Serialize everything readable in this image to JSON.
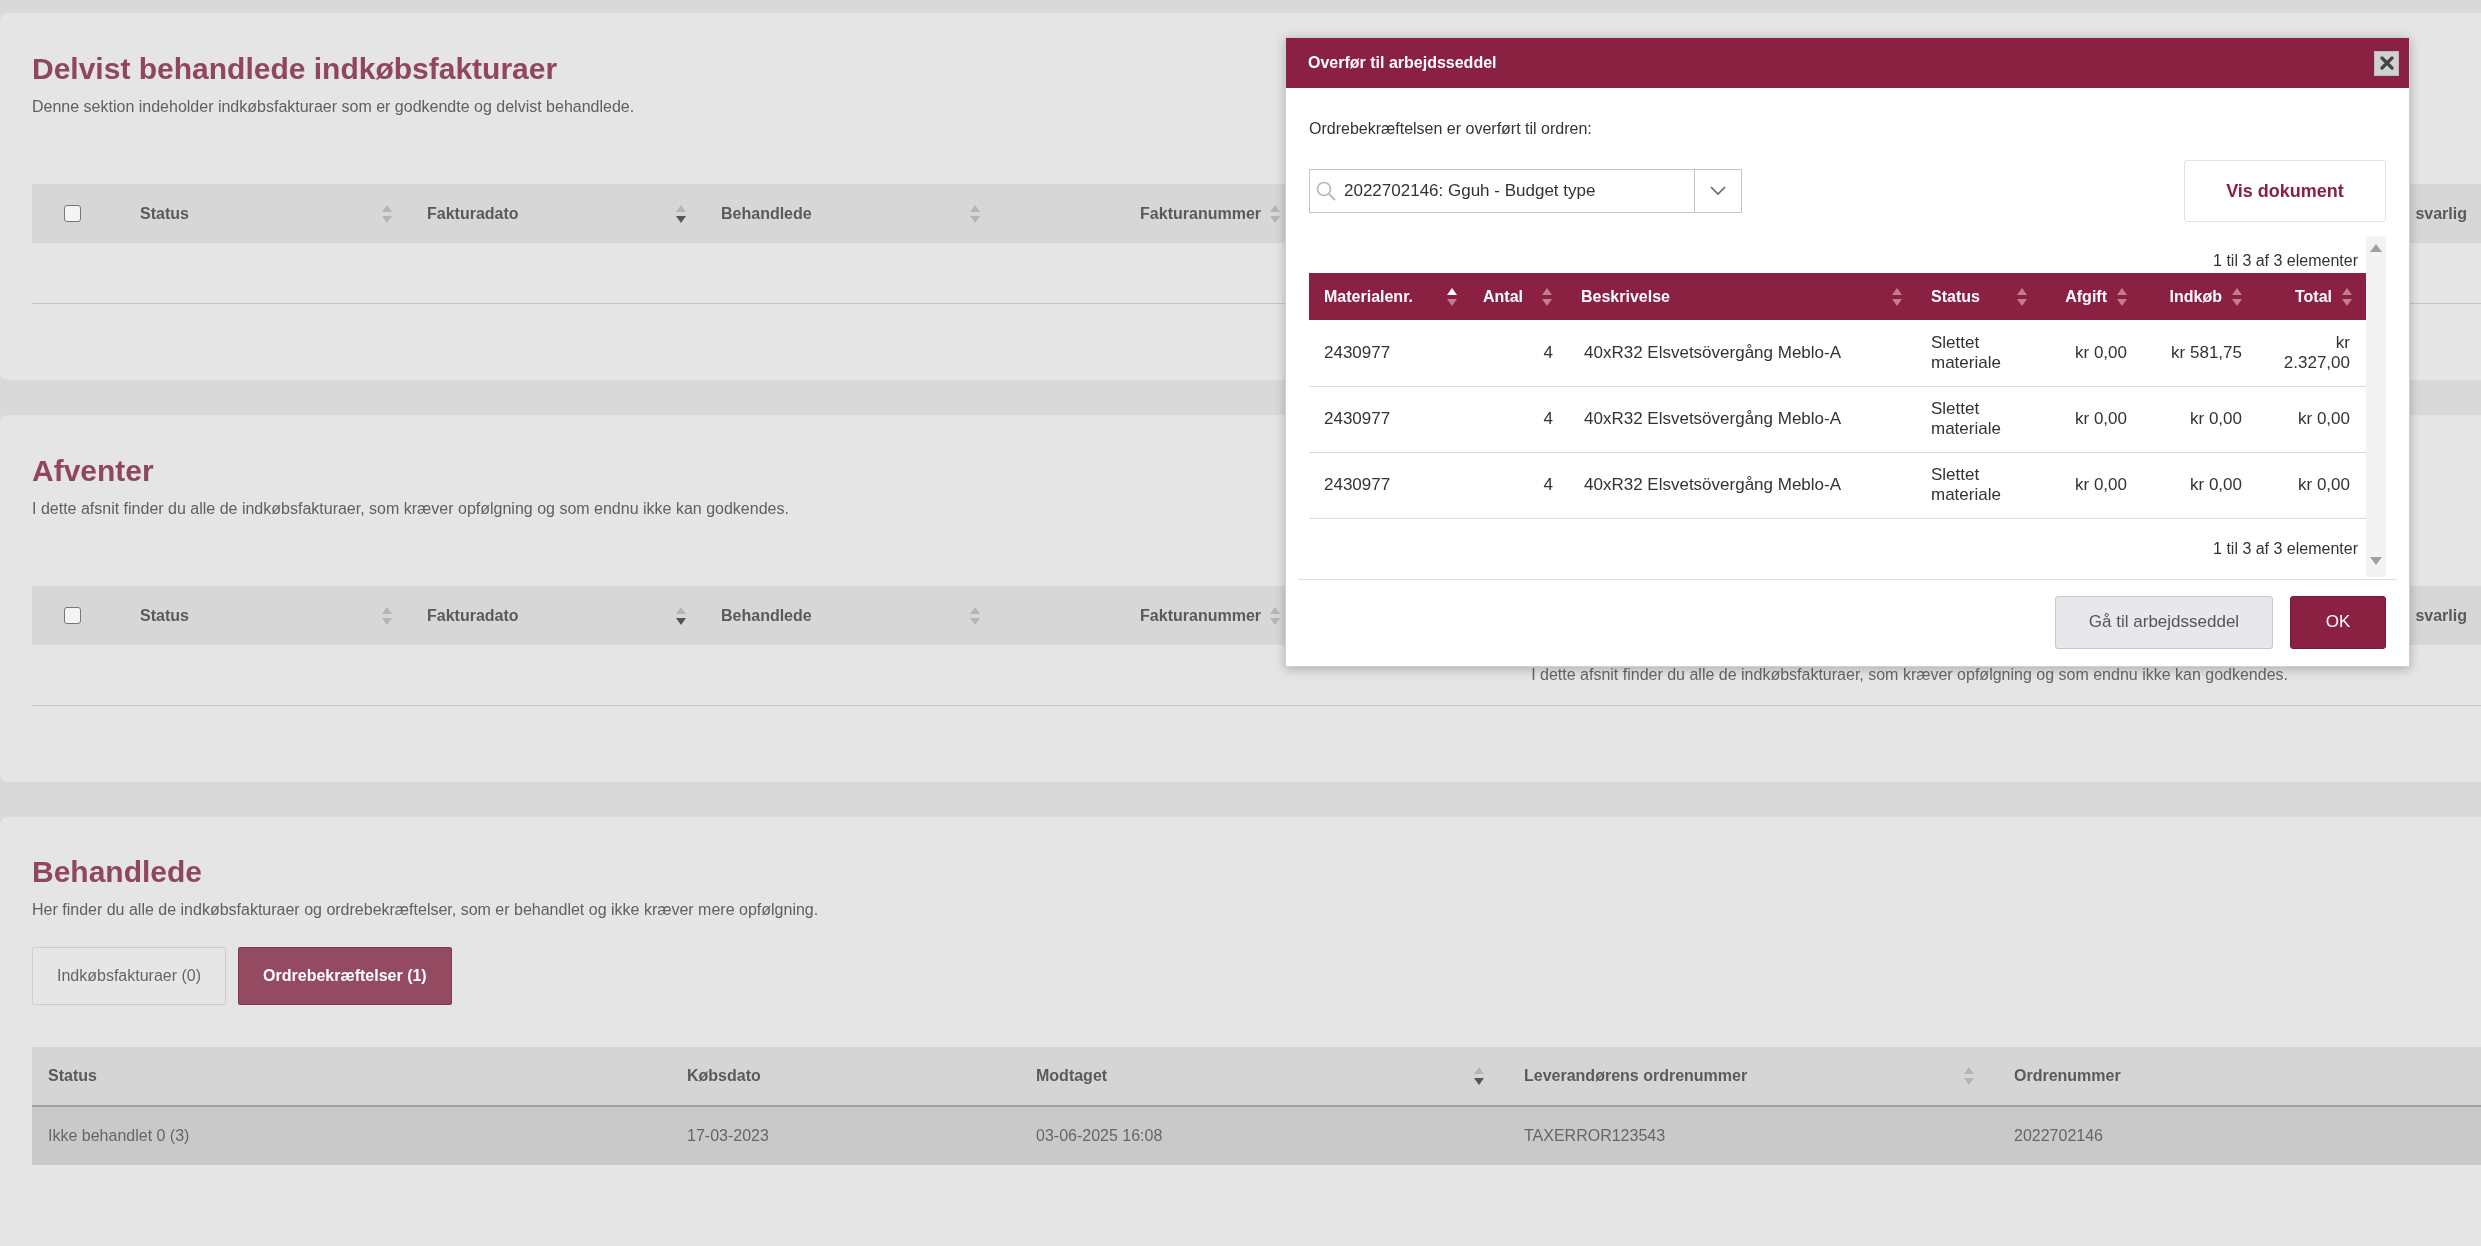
{
  "sections": [
    {
      "title": "Delvist behandlede indkøbsfakturaer",
      "description": "Denne sektion indeholder indkøbsfakturaer som er godkendte og delvist behandlede.",
      "table": {
        "select_all": {
          "checked": false
        },
        "columns": [
          {
            "label": "Status",
            "sorted_up": false,
            "sorted_down": false
          },
          {
            "label": "Fakturadato",
            "sorted_up": false,
            "sorted_down": true
          },
          {
            "label": "Behandlede",
            "sorted_up": false,
            "sorted_down": false
          },
          {
            "label": "Fakturanummer",
            "sorted_up": false,
            "sorted_down": false
          },
          {
            "label": "svarlig"
          }
        ]
      }
    },
    {
      "title": "Afventer",
      "description": "I dette afsnit finder du alle de indkøbsfakturaer, som kræver opfølgning og som endnu ikke kan godkendes.",
      "table": {
        "select_all": {
          "checked": false
        },
        "columns": [
          {
            "label": "Status",
            "sorted_up": false,
            "sorted_down": false
          },
          {
            "label": "Fakturadato",
            "sorted_up": false,
            "sorted_down": true
          },
          {
            "label": "Behandlede",
            "sorted_up": false,
            "sorted_down": false
          },
          {
            "label": "Fakturanummer",
            "sorted_up": false,
            "sorted_down": false
          },
          {
            "label": "svarlig"
          }
        ],
        "empty_message": "I dette afsnit finder du alle de indkøbsfakturaer, som kræver opfølgning og som endnu ikke kan godkendes."
      }
    }
  ],
  "processed": {
    "title": "Behandlede",
    "description": "Her finder du alle de indkøbsfakturaer og ordrebekræftelser, som er behandlet og ikke kræver mere opfølgning.",
    "tabs": [
      {
        "label": "Indkøbsfakturaer (0)",
        "selected": false
      },
      {
        "label": "Ordrebekræftelser (1)",
        "selected": true
      }
    ],
    "table": {
      "columns": [
        {
          "label": "Status"
        },
        {
          "label": "Købsdato"
        },
        {
          "label": "Modtaget",
          "sorted_up": false,
          "sorted_down": true
        },
        {
          "label": "Leverandørens ordrenummer",
          "sorted_up": false,
          "sorted_down": false
        },
        {
          "label": "Ordrenummer"
        }
      ],
      "rows": [
        {
          "selected": true,
          "cells": [
            "Ikke behandlet 0 (3)",
            "17-03-2023",
            "03-06-2025 16:08",
            "TAXERROR123543",
            "2022702146"
          ]
        }
      ]
    }
  },
  "dialog": {
    "title": "Overfør til arbejdsseddel",
    "message": "Ordrebekræftelsen er overført til ordren:",
    "order_field": {
      "value": "2022702146: Gguh - Budget type"
    },
    "view_button": "Vis dokument",
    "count_top": "1 til 3 af 3 elementer",
    "columns": [
      {
        "label": "Materialenr.",
        "sorted_up": true,
        "sorted_down": false
      },
      {
        "label": "Antal",
        "sorted_up": false,
        "sorted_down": false
      },
      {
        "label": "Beskrivelse",
        "sorted_up": false,
        "sorted_down": false
      },
      {
        "label": "Status",
        "sorted_up": false,
        "sorted_down": false
      },
      {
        "label": "Afgift",
        "sorted_up": false,
        "sorted_down": false
      },
      {
        "label": "Indkøb",
        "sorted_up": false,
        "sorted_down": false
      },
      {
        "label": "Total",
        "sorted_up": false,
        "sorted_down": false
      }
    ],
    "rows": [
      {
        "cells": [
          "2430977",
          "4",
          "40xR32 Elsvetsövergång Meblo-A",
          "Slettet materiale",
          "kr 0,00",
          "kr 581,75",
          "kr 2.327,00"
        ]
      },
      {
        "cells": [
          "2430977",
          "4",
          "40xR32 Elsvetsövergång Meblo-A",
          "Slettet materiale",
          "kr 0,00",
          "kr 0,00",
          "kr 0,00"
        ]
      },
      {
        "cells": [
          "2430977",
          "4",
          "40xR32 Elsvetsövergång Meblo-A",
          "Slettet materiale",
          "kr 0,00",
          "kr 0,00",
          "kr 0,00"
        ]
      }
    ],
    "count_bottom": "1 til 3 af 3 elementer",
    "buttons": [
      {
        "label": "Gå til arbejdsseddel",
        "kind": "secondary"
      },
      {
        "label": "OK",
        "kind": "primary"
      }
    ]
  }
}
